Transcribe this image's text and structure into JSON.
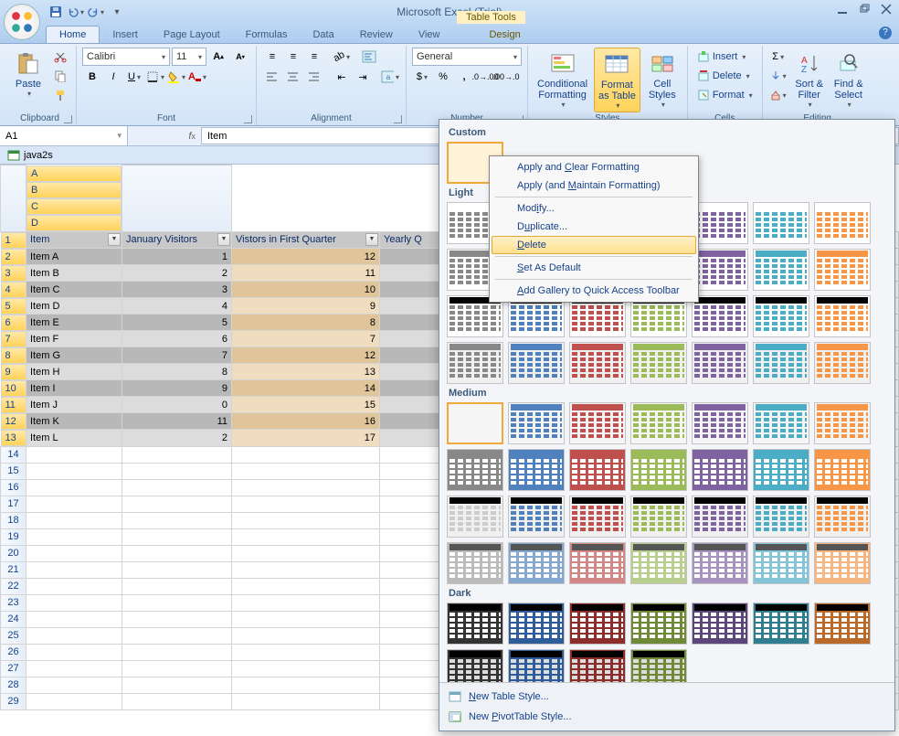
{
  "app": {
    "title": "Microsoft Excel (Trial)"
  },
  "table_tools": {
    "label": "Table Tools"
  },
  "tabs": [
    "Home",
    "Insert",
    "Page Layout",
    "Formulas",
    "Data",
    "Review",
    "View",
    "Design"
  ],
  "active_tab": 0,
  "ribbon": {
    "clipboard": {
      "label": "Clipboard",
      "paste": "Paste"
    },
    "font": {
      "label": "Font",
      "face": "Calibri",
      "size": "11"
    },
    "alignment": {
      "label": "Alignment"
    },
    "number": {
      "label": "Number",
      "format": "General"
    },
    "styles": {
      "label": "Styles",
      "cond": "Conditional\nFormatting",
      "fmt": "Format\nas Table",
      "cell": "Cell\nStyles"
    },
    "cells": {
      "label": "Cells",
      "insert": "Insert",
      "delete": "Delete",
      "format": "Format"
    },
    "editing": {
      "label": "Editing",
      "sort": "Sort &\nFilter",
      "find": "Find &\nSelect"
    }
  },
  "namebox": "A1",
  "formula_value": "Item",
  "workbook_tab": "java2s",
  "columns": [
    "A",
    "B",
    "C",
    "D"
  ],
  "headers": [
    "Item",
    "January Visitors",
    "Vistors in First Quarter",
    "Yearly Q"
  ],
  "rows": [
    {
      "item": "Item A",
      "jan": "1",
      "q1": "12"
    },
    {
      "item": "Item B",
      "jan": "2",
      "q1": "11"
    },
    {
      "item": "Item C",
      "jan": "3",
      "q1": "10"
    },
    {
      "item": "Item D",
      "jan": "4",
      "q1": "9"
    },
    {
      "item": "Item E",
      "jan": "5",
      "q1": "8"
    },
    {
      "item": "Item F",
      "jan": "6",
      "q1": "7"
    },
    {
      "item": "Item G",
      "jan": "7",
      "q1": "12"
    },
    {
      "item": "Item H",
      "jan": "8",
      "q1": "13"
    },
    {
      "item": "Item I",
      "jan": "9",
      "q1": "14"
    },
    {
      "item": "Item J",
      "jan": "0",
      "q1": "15"
    },
    {
      "item": "Item K",
      "jan": "11",
      "q1": "16"
    },
    {
      "item": "Item L",
      "jan": "2",
      "q1": "17"
    }
  ],
  "empty_rows": 16,
  "gallery": {
    "sections": {
      "custom": "Custom",
      "light": "Light",
      "medium": "Medium",
      "dark": "Dark"
    },
    "new_table": "New Table Style...",
    "new_pivot": "New PivotTable Style..."
  },
  "ctx": {
    "apply_clear": "Apply and Clear Formatting",
    "apply_maintain": "Apply (and Maintain Formatting)",
    "modify": "Modify...",
    "duplicate": "Duplicate...",
    "delete": "Delete",
    "set_default": "Set As Default",
    "add_qat": "Add Gallery to Quick Access Toolbar"
  },
  "style_colors": {
    "light_accents": [
      "#888888",
      "#4e81bd",
      "#c0504d",
      "#9bbb59",
      "#7f63a1",
      "#4bacc6",
      "#f79646"
    ],
    "medium_accents": [
      "#888888",
      "#4e81bd",
      "#c0504d",
      "#9bbb59",
      "#7f63a1",
      "#4bacc6",
      "#f79646"
    ],
    "dark_accents": [
      "#333333",
      "#2e5b9a",
      "#8b2e2b",
      "#6e8a36",
      "#5c4578",
      "#2f7e90",
      "#b96a29"
    ]
  }
}
